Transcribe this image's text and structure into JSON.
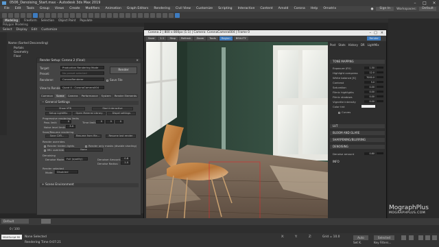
{
  "window": {
    "title": "0506_Denoising_Start.max - Autodesk 3ds Max 2019"
  },
  "menu": [
    "File",
    "Edit",
    "Tools",
    "Group",
    "Views",
    "Create",
    "Modifiers",
    "Animation",
    "Graph Editors",
    "Rendering",
    "Civil View",
    "Customize",
    "Scripting",
    "Interactive",
    "Content",
    "Arnold",
    "Corona",
    "Help",
    "Ornatrix"
  ],
  "menu_right": {
    "signin": "Sign In",
    "workspace_label": "Workspaces:",
    "workspace": "Default"
  },
  "ribbon": {
    "tabs": [
      "Modeling",
      "Freeform",
      "Selection",
      "Object Paint",
      "Populate"
    ],
    "active": "Modeling",
    "sub": "Polygon Modeling"
  },
  "scene": {
    "tabs": [
      "Select",
      "Display",
      "Edit",
      "Customize"
    ],
    "items": [
      "Name (Sorted Descending)",
      "Portals",
      "Geometry",
      "Floor"
    ]
  },
  "render_setup": {
    "title": "Render Setup: Corona 2 (Final)",
    "target_label": "Target:",
    "target": "Production Rendering Mode",
    "preset_label": "Preset:",
    "preset": "No preset selected",
    "renderer_label": "Renderer:",
    "renderer": "CoronaRenderer",
    "save_file": "Save File",
    "view_label": "View to Render:",
    "view": "Quad 4 - CoronaCamera004",
    "render_button": "Render",
    "tabs": [
      "Common",
      "Scene",
      "Camera",
      "Performance",
      "System",
      "Render Elements"
    ],
    "active_tab": "Scene",
    "general_settings": "General Settings",
    "buttons": [
      "Show VFB",
      "Start Interactive",
      "Setup LightMix",
      "Open Material Library",
      "Dispel settings"
    ],
    "progressive_label": "Progressive rendering limits",
    "pass_limit_label": "Pass limit:",
    "pass_limit": "0",
    "time_limit_label": "Time limit:",
    "time_limit": "0",
    "noise_level_label": "Noise level limit:",
    "noise_level": "3.0",
    "save_resume_label": "Save/Resume rendering",
    "save_cxr": "Save CXR...",
    "resume_file": "Resume from file...",
    "resume_last": "Resume last render",
    "overrides_label": "Render overrides",
    "render_hidden": "Render hidden lights",
    "render_masks": "Render only masks (disable shading)",
    "mtl_override": "Mtl. override:",
    "mtl_value": "None",
    "denoising_label": "Denoising",
    "denoise_mode_label": "Denoise Mode:",
    "denoise_mode": "Full (quality)",
    "denoiser_amount_label": "Denoiser Amount:",
    "denoiser_amount": "0.8",
    "denoise_radius_label": "Denoise Radius:",
    "denoise_radius": "1.0",
    "render_selected_label": "Render selected",
    "mode_label": "Mode:",
    "mode": "Disabled",
    "scene_env": "Scene Environment"
  },
  "vfb": {
    "title": "Corona 2 | 800 x 800px (1:1) | Camera: CoronaCamera004 | Frame 0",
    "toolbar": [
      "Save",
      "1:1",
      "Stop",
      "Refresh",
      "Zoom",
      "Tools",
      "Region",
      "BEAUTY"
    ],
    "render_button": "Render",
    "panel_tabs": [
      "Post",
      "Stats",
      "History",
      "DR",
      "LightMix"
    ],
    "tone_mapping": "TONE MAPPING",
    "tone_rows": [
      {
        "label": "Exposure (EV)",
        "value": "1.50"
      },
      {
        "label": "Highlight compress",
        "value": "12.0"
      },
      {
        "label": "White balance [K]",
        "value": "7000.0"
      },
      {
        "label": "Contrast",
        "value": "3.0"
      },
      {
        "label": "Saturation",
        "value": "0.00"
      },
      {
        "label": "Filmic highlights",
        "value": "0.00"
      },
      {
        "label": "Filmic shadows",
        "value": "0.00"
      },
      {
        "label": "Vignette intensity",
        "value": "0.00"
      },
      {
        "label": "Color tint",
        "value": ""
      }
    ],
    "curves": "Curves",
    "sections": [
      "LUT",
      "BLOOM AND GLARE",
      "SHARPENING/BLURRING",
      "DENOISING"
    ],
    "denoise_amount_label": "Denoise amount",
    "denoise_amount": "0.80",
    "info": "INFO"
  },
  "status": {
    "none_selected": "None Selected",
    "rendering_time": "Rendering Time 0:07:21",
    "frame": "0 / 100",
    "selected": "Selected",
    "x": "X:",
    "y": "Y:",
    "z": "Z:",
    "grid": "Grid = 10.0",
    "auto": "Auto",
    "set_key": "Set K.",
    "filters": "Key Filters...",
    "maxscript": "MAXScript Mi",
    "default": "Default"
  },
  "watermark": {
    "line1": "MographPlus",
    "line2": "MOGRAPHPLUS.COM"
  },
  "colors": {
    "accent": "#3d7bc0",
    "wall": "#2f4a3f",
    "floor": "#6b5a4a"
  }
}
